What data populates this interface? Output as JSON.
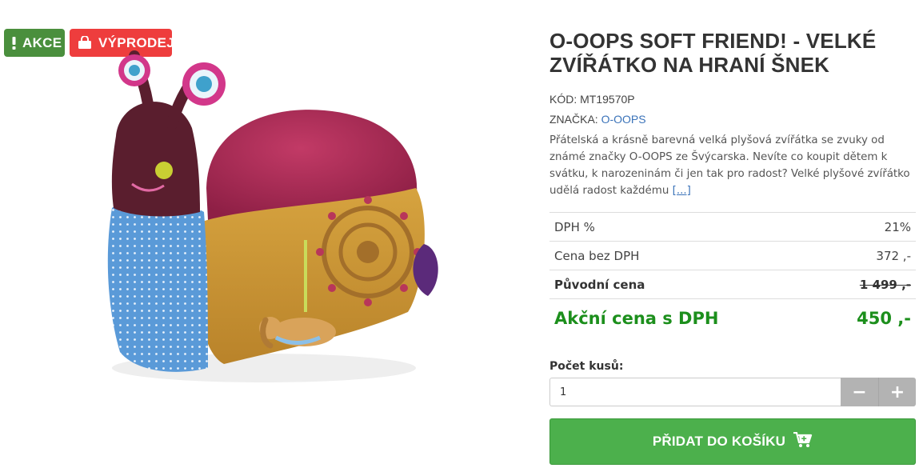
{
  "badges": {
    "akce": {
      "label": "AKCE",
      "color": "#4a8f3d",
      "icon": "exclamation-icon"
    },
    "sale": {
      "label": "VÝPRODEJ",
      "color": "#ee3d3d",
      "icon": "shopping-bag-icon"
    }
  },
  "product": {
    "image_alt": "O-OOPS Soft Friend! - snail plush toy",
    "title": "O-OOPS SOFT FRIEND! - VELKÉ ZVÍŘÁTKO NA HRANÍ ŠNEK",
    "code_label": "KÓD:",
    "code_value": "MT19570P",
    "brand_label": "ZNAČKA:",
    "brand_value": "O-OOPS",
    "description": "Přátelská a krásně barevná velká plyšová zvířátka se zvuky od známé značky O-OOPS ze Švýcarska. Nevíte co koupit dětem k svátku, k narozeninám či jen tak pro radost? Velké plyšové zvířátko udělá radost každému",
    "more_link": "[...]"
  },
  "prices": {
    "vat_label": "DPH %",
    "vat_value": "21%",
    "net_label": "Cena bez DPH",
    "net_value": "372 ,-",
    "original_label": "Původní cena",
    "original_value": "1 499 ,-",
    "final_label": "Akční cena s DPH",
    "final_value": "450 ,-",
    "final_color": "#1c8f1c"
  },
  "quantity": {
    "label": "Počet kusů:",
    "value": "1",
    "minus": "−",
    "plus": "+"
  },
  "cart": {
    "label": "PŘIDAT DO KOŠÍKU",
    "icon": "cart-plus-icon",
    "color": "#4cb04c"
  }
}
